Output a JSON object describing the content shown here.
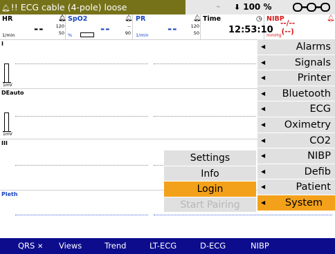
{
  "status_bar": {
    "alarm_icon": "bell-icon",
    "alarm_message": "!! ECG cable (4-pole) loose",
    "plug_icon": "power-plug-icon",
    "battery_icon": "battery-icon",
    "battery_level": "100 %",
    "network_icon": "connection-chain-icon",
    "alarm_color": "#76721a"
  },
  "params": {
    "hr": {
      "label": "HR",
      "value": "--",
      "limit_high": "120",
      "limit_low": "50",
      "unit": "1/min"
    },
    "spo2": {
      "label": "SpO2",
      "value": "--",
      "limit_high": "--",
      "limit_low": "90",
      "unit": "%"
    },
    "pr": {
      "label": "PR",
      "value": "--",
      "limit_high": "120",
      "limit_low": "50",
      "unit": "1/min"
    },
    "time": {
      "label": "Time",
      "value": "12:53:10"
    },
    "nibp": {
      "label": "NIBP",
      "value": "--/--",
      "value2": "(--)",
      "unit": "mmHg"
    }
  },
  "waveforms": [
    {
      "label": "I",
      "calibration": "1mV"
    },
    {
      "label": "DEauto",
      "calibration": "1mV"
    },
    {
      "label": "III"
    },
    {
      "label": "Pleth"
    }
  ],
  "main_menu": [
    {
      "label": "Alarms",
      "selected": false
    },
    {
      "label": "Signals",
      "selected": false
    },
    {
      "label": "Printer",
      "selected": false
    },
    {
      "label": "Bluetooth",
      "selected": false
    },
    {
      "label": "ECG",
      "selected": false
    },
    {
      "label": "Oximetry",
      "selected": false
    },
    {
      "label": "CO2",
      "selected": false
    },
    {
      "label": "NIBP",
      "selected": false
    },
    {
      "label": "Defib",
      "selected": false
    },
    {
      "label": "Patient",
      "selected": false
    },
    {
      "label": "System",
      "selected": true
    }
  ],
  "sub_menu": [
    {
      "label": "Settings",
      "state": "normal"
    },
    {
      "label": "Info",
      "state": "normal"
    },
    {
      "label": "Login",
      "state": "selected"
    },
    {
      "label": "Start Pairing",
      "state": "disabled"
    }
  ],
  "bottom_bar": {
    "items": [
      "QRS",
      "Views",
      "Trend",
      "LT-ECG",
      "D-ECG",
      "NIBP"
    ],
    "qrs_icon": "speaker-muted-icon",
    "background": "#0c0c8c"
  },
  "colors": {
    "selected": "#f3a11a",
    "menu_bg": "#e0e0e0",
    "blue_param": "#1744c2",
    "red_param": "#d81e1e"
  }
}
